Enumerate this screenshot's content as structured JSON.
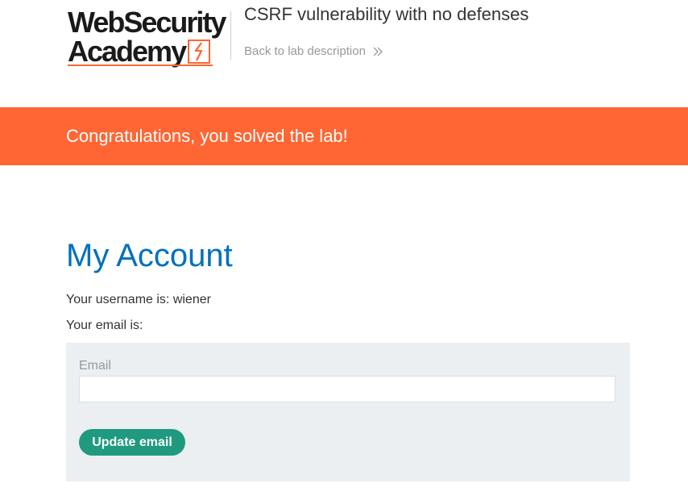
{
  "header": {
    "logo_line1": "WebSecurity",
    "logo_line2": "Academy",
    "lab_title": "CSRF vulnerability with no defenses",
    "back_link": "Back to lab description",
    "back_icon": "double-chevron-right-icon"
  },
  "banner": {
    "message": "Congratulations, you solved the lab!"
  },
  "main": {
    "title": "My Account",
    "username_line": "Your username is: wiener",
    "email_line": "Your email is:",
    "form": {
      "email_label": "Email",
      "email_value": "",
      "submit_label": "Update email"
    }
  },
  "colors": {
    "brand_orange": "#ff6633",
    "heading_blue": "#0071bc",
    "button_green": "#1f9a7e",
    "panel_gray": "#ebeff2"
  }
}
